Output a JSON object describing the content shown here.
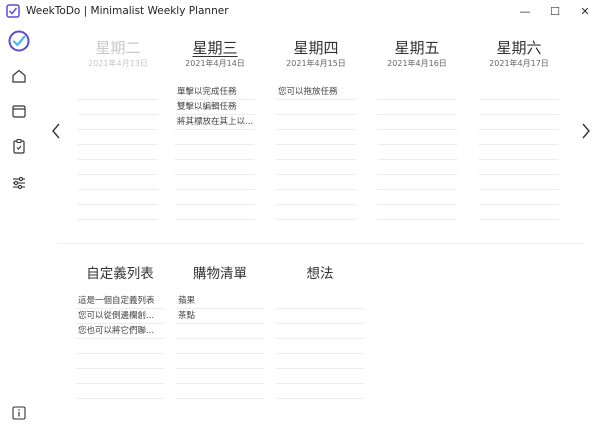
{
  "window": {
    "title": "WeekToDo | Minimalist Weekly Planner",
    "minimize": "—",
    "maximize": "☐",
    "close": "✕"
  },
  "sidebar": {
    "items": [
      {
        "name": "home",
        "icon": "home-icon"
      },
      {
        "name": "calendar",
        "icon": "calendar-icon"
      },
      {
        "name": "clipboard",
        "icon": "clipboard-icon"
      },
      {
        "name": "settings",
        "icon": "sliders-icon"
      },
      {
        "name": "info",
        "icon": "info-icon"
      }
    ]
  },
  "days": [
    {
      "name": "星期二",
      "date": "2021年4月13日",
      "state": "past",
      "tasks": []
    },
    {
      "name": "星期三",
      "date": "2021年4月14日",
      "state": "today",
      "tasks": [
        "單擊以完成任務",
        "雙擊以編輯任務",
        "將其標放在其上以..."
      ]
    },
    {
      "name": "星期四",
      "date": "2021年4月15日",
      "state": "future",
      "tasks": [
        "您可以拖放任務"
      ]
    },
    {
      "name": "星期五",
      "date": "2021年4月16日",
      "state": "future",
      "tasks": []
    },
    {
      "name": "星期六",
      "date": "2021年4月17日",
      "state": "future",
      "tasks": []
    }
  ],
  "lists": [
    {
      "title": "自定義列表",
      "items": [
        "這是一個自定義列表",
        "您可以從側邊欄創...",
        "您也可以將它們聯..."
      ]
    },
    {
      "title": "購物清單",
      "items": [
        "蘋果",
        "茶點"
      ]
    },
    {
      "title": "想法",
      "items": []
    }
  ],
  "colors": {
    "accent": "#5b4bd6",
    "past_text": "#c8c8c8",
    "line": "#ececec"
  }
}
